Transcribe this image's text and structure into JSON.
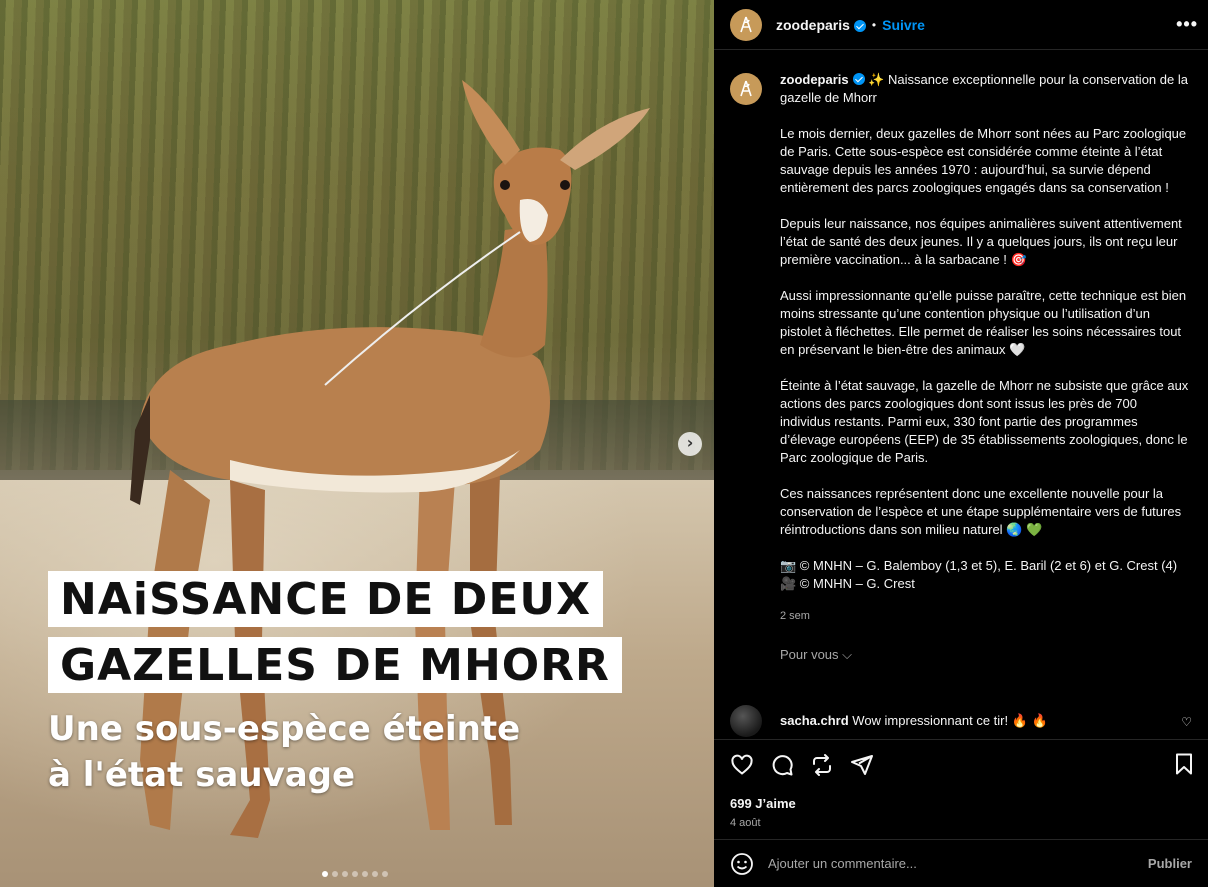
{
  "media": {
    "headline_line1": "NAiSSANCE DE DEUX",
    "headline_line2": "GAZELLES DE MHORR",
    "subline_line1": "Une sous-espèce éteinte",
    "subline_line2": "à l'état sauvage",
    "next_arrow": "›",
    "slide_count": 7,
    "active_slide": 1
  },
  "header": {
    "username": "zoodeparis",
    "separator": "•",
    "follow_label": "Suivre",
    "more_label": "•••"
  },
  "caption": {
    "username": "zoodeparis",
    "lead": "✨ Naissance exceptionnelle pour la conservation de la gazelle de Mhorr",
    "p1": "Le mois dernier, deux gazelles de Mhorr sont nées au Parc zoologique de Paris. Cette sous-espèce est considérée comme éteinte à l’état sauvage depuis les années 1970 : aujourd’hui, sa survie dépend entièrement des parcs zoologiques engagés dans sa conservation !",
    "p2": "Depuis leur naissance, nos équipes animalières suivent attentivement l’état de santé des deux jeunes. Il y a quelques jours, ils ont reçu leur première vaccination... à la sarbacane ! 🎯",
    "p3": "Aussi impressionnante qu’elle puisse paraître, cette technique est bien moins stressante qu’une contention physique ou l’utilisation d’un pistolet à fléchettes. Elle permet de réaliser les soins nécessaires tout en préservant le bien-être des animaux 🤍",
    "p4": "Éteinte à l’état sauvage, la gazelle de Mhorr ne subsiste que grâce aux actions des parcs zoologiques dont sont issus les près de 700 individus restants. Parmi eux, 330 font partie des programmes d’élevage européens (EEP) de 35 établissements zoologiques, donc le Parc zoologique de Paris.",
    "p5": "Ces naissances représentent donc une excellente nouvelle pour la conservation de l’espèce et une étape supplémentaire vers de futures réintroductions dans son milieu naturel 🌏 💚",
    "credit1": "📷 © MNHN – G. Balemboy (1,3 et 5), E. Baril (2 et 6) et G. Crest (4)",
    "credit2": "🎥 © MNHN – G. Crest",
    "age": "2 sem"
  },
  "see_more": "Pour vous ⌵",
  "comment": {
    "username": "sacha.chrd",
    "text": "Wow impressionnant ce tir! 🔥 🔥",
    "like_icon": "♡"
  },
  "actions": {
    "likes": "699 J’aime",
    "date": "4 août"
  },
  "add_comment": {
    "placeholder": "Ajouter un commentaire...",
    "publish_label": "Publier"
  },
  "colors": {
    "background": "#000000",
    "text": "#f5f5f5",
    "secondary_text": "#a8a8a8",
    "accent": "#0095f6",
    "divider": "#262626"
  }
}
